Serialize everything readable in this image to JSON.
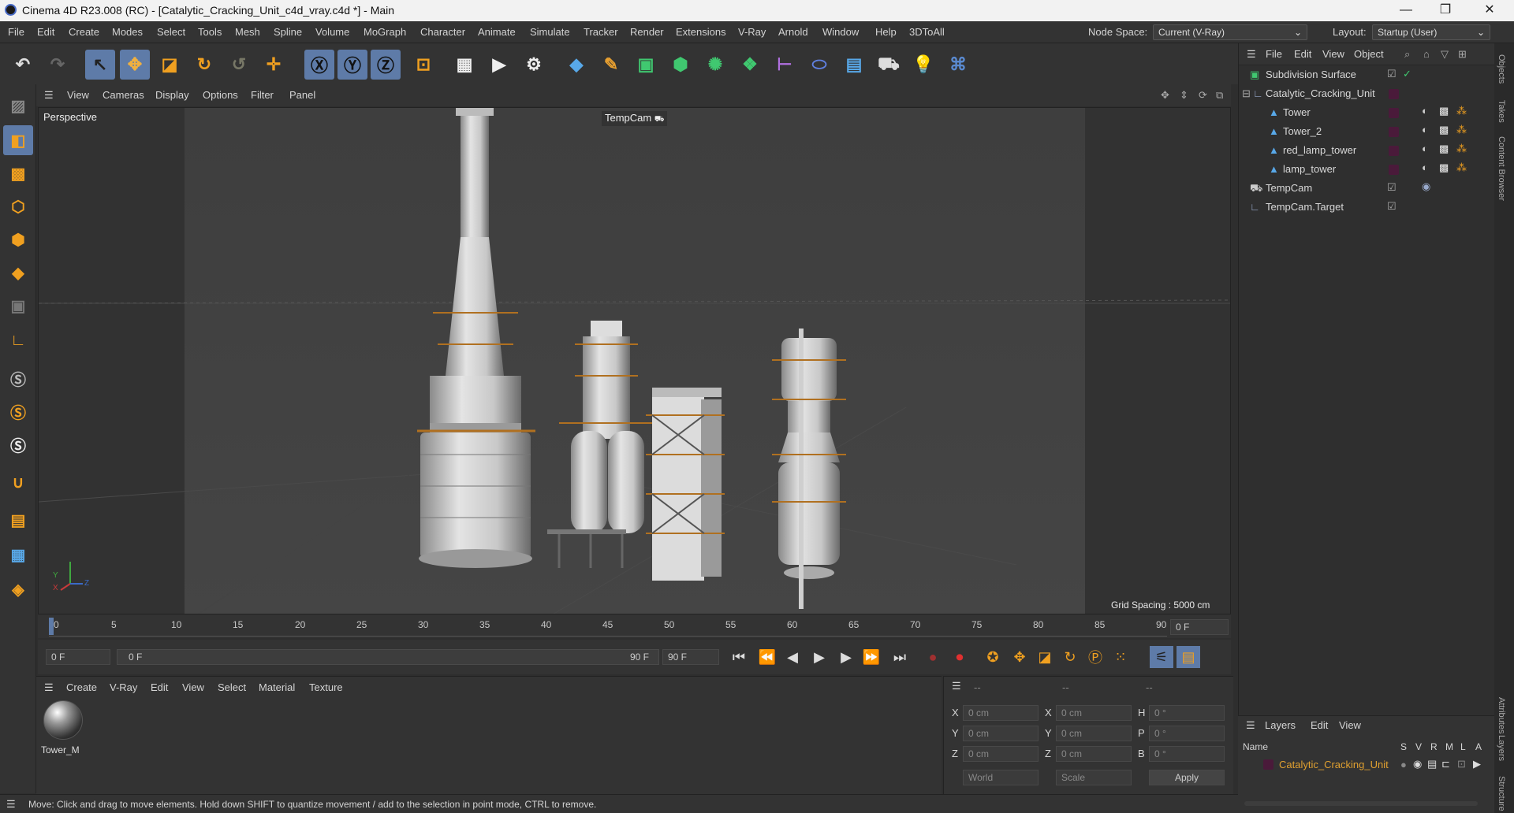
{
  "window": {
    "title": "Cinema 4D R23.008 (RC) - [Catalytic_Cracking_Unit_c4d_vray.c4d *] - Main",
    "minimize": "—",
    "restore": "❐",
    "close": "✕"
  },
  "menu": {
    "items": [
      "File",
      "Edit",
      "Create",
      "Modes",
      "Select",
      "Tools",
      "Mesh",
      "Spline",
      "Volume",
      "MoGraph",
      "Character",
      "Animate",
      "Simulate",
      "Tracker",
      "Render",
      "Extensions",
      "V-Ray",
      "Arnold",
      "Window",
      "Help",
      "3DToAll"
    ],
    "node_space_label": "Node Space:",
    "node_space_value": "Current (V-Ray)",
    "layout_label": "Layout:",
    "layout_value": "Startup (User)"
  },
  "viewport": {
    "menu": [
      "View",
      "Cameras",
      "Display",
      "Options",
      "Filter",
      "Panel"
    ],
    "view_name": "Perspective",
    "camera_name": "TempCam",
    "grid_spacing": "Grid Spacing : 5000 cm",
    "axis_x": "X",
    "axis_y": "Y",
    "axis_z": "Z"
  },
  "objects": {
    "menu": [
      "File",
      "Edit",
      "View",
      "Object"
    ],
    "items": [
      {
        "name": "Subdivision Surface",
        "indent": 0,
        "icon": "subdivision-icon"
      },
      {
        "name": "Catalytic_Cracking_Unit",
        "indent": 0,
        "icon": "null-object-icon"
      },
      {
        "name": "Tower",
        "indent": 1,
        "icon": "polygon-object-icon"
      },
      {
        "name": "Tower_2",
        "indent": 1,
        "icon": "polygon-object-icon"
      },
      {
        "name": "red_lamp_tower",
        "indent": 1,
        "icon": "polygon-object-icon"
      },
      {
        "name": "lamp_tower",
        "indent": 1,
        "icon": "polygon-object-icon"
      },
      {
        "name": "TempCam",
        "indent": 0,
        "icon": "camera-icon"
      },
      {
        "name": "TempCam.Target",
        "indent": 0,
        "icon": "null-object-icon"
      }
    ],
    "layer_color": "#4a1a3a"
  },
  "side_tabs": [
    "Objects",
    "Takes",
    "Content Browser",
    "Attributes",
    "Layers",
    "Structure"
  ],
  "timeline": {
    "ticks": [
      "0",
      "5",
      "10",
      "15",
      "20",
      "25",
      "30",
      "35",
      "40",
      "45",
      "50",
      "55",
      "60",
      "65",
      "70",
      "75",
      "80",
      "85",
      "90"
    ],
    "current_frame": "0 F",
    "start_frame": "0 F",
    "range_start": "0 F",
    "range_end": "90 F",
    "end_frame": "90 F"
  },
  "materials": {
    "menu": [
      "Create",
      "V-Ray",
      "Edit",
      "View",
      "Select",
      "Material",
      "Texture"
    ],
    "items": [
      {
        "name": "Tower_M"
      }
    ]
  },
  "coordinates": {
    "header": [
      "--",
      "--",
      "--"
    ],
    "rows": [
      {
        "a": "X",
        "av": "0 cm",
        "b": "X",
        "bv": "0 cm",
        "c": "H",
        "cv": "0 °"
      },
      {
        "a": "Y",
        "av": "0 cm",
        "b": "Y",
        "bv": "0 cm",
        "c": "P",
        "cv": "0 °"
      },
      {
        "a": "Z",
        "av": "0 cm",
        "b": "Z",
        "bv": "0 cm",
        "c": "B",
        "cv": "0 °"
      }
    ],
    "mode1": "World",
    "mode2": "Scale",
    "apply": "Apply"
  },
  "layers": {
    "menu": [
      "Layers",
      "Edit",
      "View"
    ],
    "header_name": "Name",
    "flags": [
      "S",
      "V",
      "R",
      "M",
      "L",
      "A"
    ],
    "items": [
      {
        "name": "Catalytic_Cracking_Unit",
        "color": "#4a1a3a"
      }
    ]
  },
  "status": {
    "text": "Move: Click and drag to move elements. Hold down SHIFT to quantize movement / add to the selection in point mode, CTRL to remove."
  },
  "colors": {
    "accent": "#5e7ba8",
    "layer_name": "#e0a030",
    "ground": "#3a3a3a"
  }
}
